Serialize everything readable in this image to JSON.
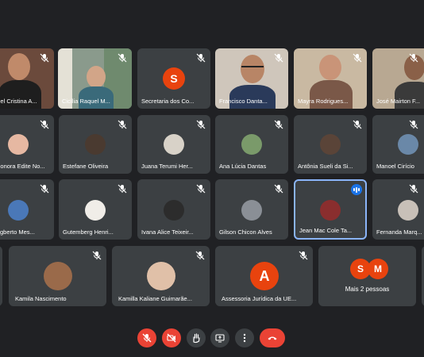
{
  "colors": {
    "background": "#202124",
    "tile": "#3c4043",
    "active_border": "#8ab4f8",
    "end_call": "#ea4335"
  },
  "participants": {
    "row1": [
      {
        "name": "Hel Cristina A..."
      },
      {
        "name": "Cicília Raquel M..."
      },
      {
        "name": "Secretaria dos Co...",
        "initial": "S"
      },
      {
        "name": "Francisco Danta..."
      },
      {
        "name": "Mayra Rodrigues..."
      },
      {
        "name": "José Mairton F..."
      }
    ],
    "row2": [
      {
        "name": "Honora Edite No..."
      },
      {
        "name": "Estefane Oliveira"
      },
      {
        "name": "Juana Terumi Her..."
      },
      {
        "name": "Ana Lúcia Dantas"
      },
      {
        "name": "Antônia Sueli da Si..."
      },
      {
        "name": "Manoel Cirício"
      }
    ],
    "row3": [
      {
        "name": "Egberto Mes..."
      },
      {
        "name": "Gutemberg Henri..."
      },
      {
        "name": "Ivana Alice Teixeir..."
      },
      {
        "name": "Gilson Chicon Alves"
      },
      {
        "name": "Jean Mac Cole Ta..."
      },
      {
        "name": "Fernanda Marq..."
      }
    ],
    "row4": [
      {
        "name": "Kamila Nascimento"
      },
      {
        "name": "Kamilla Kaliane Guimarãe..."
      },
      {
        "name": "Assessoria Jurídica da UE...",
        "initial": "A"
      },
      {
        "name": "Mais 2 pessoas",
        "initials": [
          "S",
          "M"
        ]
      }
    ]
  },
  "controls": {
    "mic": "mic-off-icon",
    "camera": "camera-off-icon",
    "hand": "raise-hand-icon",
    "present": "present-screen-icon",
    "more": "more-options-icon",
    "end": "end-call-icon"
  }
}
